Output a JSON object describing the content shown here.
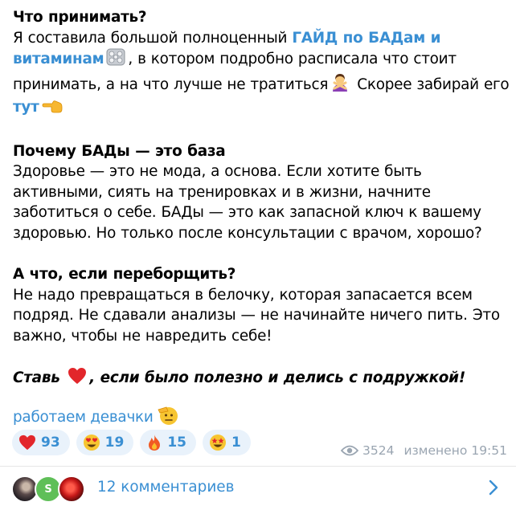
{
  "post": {
    "section1": {
      "heading": "Что принимать?",
      "text_before_link": "Я составила большой полноценный ",
      "link_guide": "ГАЙД по БАДам и витаминам",
      "pills_emoji": "pills-icon",
      "text_after_link": ", в котором подробно расписала что стоит принимать, а на что лучше не тратиться",
      "gesture_emoji": "woman-gesturing-no-icon",
      "text_tail": " Скорее забирай его ",
      "link_here": "тут",
      "pointing_emoji": "backhand-index-pointing-left-icon"
    },
    "section2": {
      "heading": "Почему БАДы — это база",
      "body": "Здоровье — это не мода, а основа. Если хотите быть активными, сиять на тренировках и в жизни, начните заботиться о себе. БАДы — это как запасной ключ к вашему здоровью. Но только после консультации с врачом, хорошо?"
    },
    "section3": {
      "heading": "А что, если переборщить?",
      "body": "Не надо превращаться в белочку, которая запасается всем подряд. Не сдавали анализы — не начинайте ничего пить. Это важно, чтобы не навредить себе!"
    },
    "cta": {
      "before": "Ставь ",
      "heart_emoji": "red-heart-icon",
      "after": ", если было полезно и делись с подружкой!"
    },
    "signature": {
      "text": "работаем девачки",
      "emoji": "saluting-face-icon"
    }
  },
  "reactions": [
    {
      "emoji": "red-heart-icon",
      "count": "93"
    },
    {
      "emoji": "heart-eyes-icon",
      "count": "19"
    },
    {
      "emoji": "fire-icon",
      "count": "15"
    },
    {
      "emoji": "star-struck-icon",
      "count": "1"
    }
  ],
  "meta": {
    "views": "3524",
    "edited_label": "изменено",
    "time": "19:51"
  },
  "comments": {
    "label": "12 комментариев",
    "avatar2_letter": "S"
  },
  "colors": {
    "link": "#3a8fd3",
    "reaction_bg": "#e9f2fb",
    "meta": "#9aa5b1"
  }
}
